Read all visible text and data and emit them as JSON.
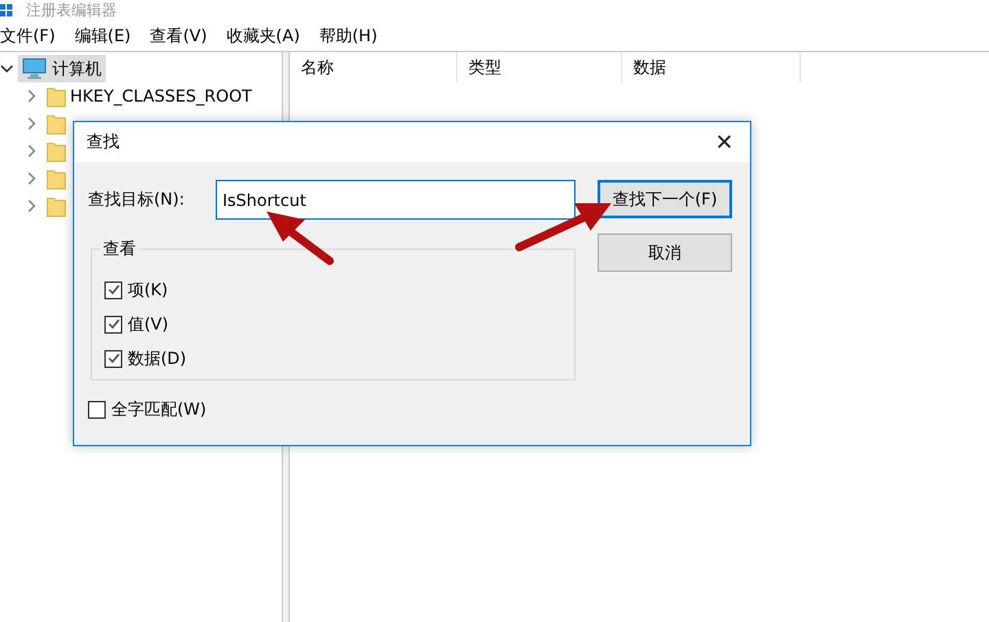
{
  "window": {
    "title": "注册表编辑器"
  },
  "menu": [
    "文件(F)",
    "编辑(E)",
    "查看(V)",
    "收藏夹(A)",
    "帮助(H)"
  ],
  "tree": {
    "label": "计算机",
    "expanded": true,
    "selected": true,
    "children": [
      {
        "label": "HKEY_CLASSES_ROOT",
        "expanded": false
      },
      {
        "expanded": false
      },
      {
        "expanded": false
      },
      {
        "expanded": false
      },
      {
        "expanded": false
      }
    ]
  },
  "list": {
    "columns": [
      "名称",
      "类型",
      "数据"
    ]
  },
  "dialog": {
    "title": "查找",
    "close": "✕",
    "find_label": "查找目标(N):",
    "find_value": "IsShortcut",
    "group": {
      "title": "查看",
      "options": [
        {
          "label": "项(K)",
          "checked": true
        },
        {
          "label": "值(V)",
          "checked": true
        },
        {
          "label": "数据(D)",
          "checked": true
        }
      ]
    },
    "whole_word": {
      "label": "全字匹配(W)",
      "checked": false
    },
    "buttons": [
      {
        "label": "查找下一个(F)",
        "default": true
      },
      {
        "label": "取消",
        "default": false
      }
    ]
  }
}
